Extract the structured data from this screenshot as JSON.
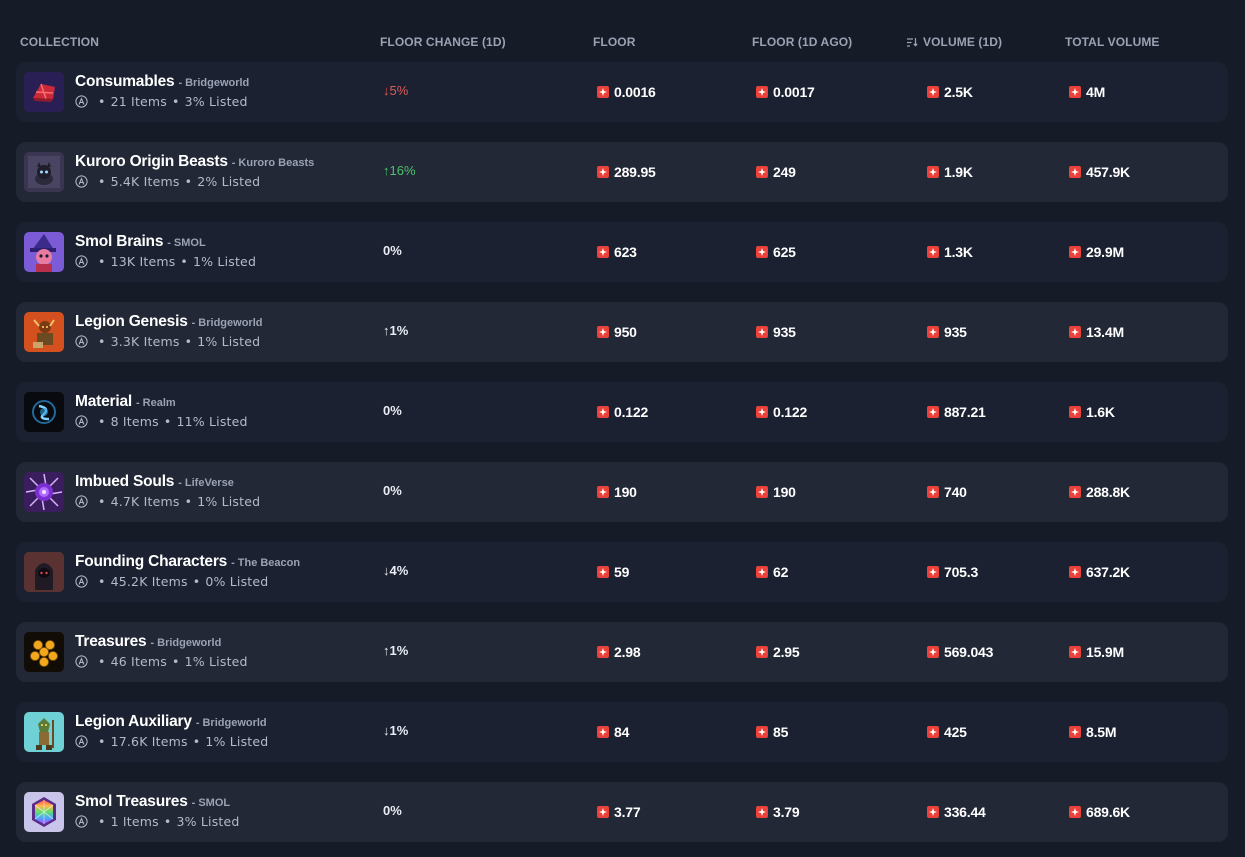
{
  "header": {
    "collection": "COLLECTION",
    "floor_change": "FLOOR CHANGE (1D)",
    "floor": "FLOOR",
    "floor_1d_ago": "FLOOR (1D AGO)",
    "volume_1d": "VOLUME (1D)",
    "total_volume": "TOTAL VOLUME"
  },
  "colors": {
    "background": "#161b28",
    "row": "#222836",
    "row_alt": "#1b2130",
    "magic_red": "#e8423a",
    "change_red": "#e05a5a",
    "change_green": "#4cc36c"
  },
  "icons": {
    "currency": "magic-token-icon",
    "chain": "arbitrum-icon",
    "sort": "sort-descending-icon"
  },
  "collections": [
    {
      "name": "Consumables",
      "sep": "-",
      "project": "Bridgeworld",
      "items": "21 Items",
      "listed": "3% Listed",
      "change": "↓5%",
      "change_style": "down-red",
      "floor": "0.0016",
      "floor_ago": "0.0017",
      "volume": "2.5K",
      "total": "4M",
      "thumb": "consumables"
    },
    {
      "name": "Kuroro Origin Beasts",
      "sep": "-",
      "project": "Kuroro Beasts",
      "items": "5.4K Items",
      "listed": "2% Listed",
      "change": "↑16%",
      "change_style": "up-green",
      "floor": "289.95",
      "floor_ago": "249",
      "volume": "1.9K",
      "total": "457.9K",
      "thumb": "kuroro"
    },
    {
      "name": "Smol Brains",
      "sep": "-",
      "project": "SMOL",
      "items": "13K Items",
      "listed": "1% Listed",
      "change": "0%",
      "change_style": "",
      "floor": "623",
      "floor_ago": "625",
      "volume": "1.3K",
      "total": "29.9M",
      "thumb": "smol"
    },
    {
      "name": "Legion Genesis",
      "sep": "-",
      "project": "Bridgeworld",
      "items": "3.3K Items",
      "listed": "1% Listed",
      "change": "↑1%",
      "change_style": "",
      "floor": "950",
      "floor_ago": "935",
      "volume": "935",
      "total": "13.4M",
      "thumb": "legion"
    },
    {
      "name": "Material",
      "sep": "-",
      "project": "Realm",
      "items": "8 Items",
      "listed": "11% Listed",
      "change": "0%",
      "change_style": "",
      "floor": "0.122",
      "floor_ago": "0.122",
      "volume": "887.21",
      "total": "1.6K",
      "thumb": "material"
    },
    {
      "name": "Imbued Souls",
      "sep": "-",
      "project": "LifeVerse",
      "items": "4.7K Items",
      "listed": "1% Listed",
      "change": "0%",
      "change_style": "",
      "floor": "190",
      "floor_ago": "190",
      "volume": "740",
      "total": "288.8K",
      "thumb": "souls"
    },
    {
      "name": "Founding Characters",
      "sep": "-",
      "project": "The Beacon",
      "items": "45.2K Items",
      "listed": "0% Listed",
      "change": "↓4%",
      "change_style": "",
      "floor": "59",
      "floor_ago": "62",
      "volume": "705.3",
      "total": "637.2K",
      "thumb": "beacon"
    },
    {
      "name": "Treasures",
      "sep": "-",
      "project": "Bridgeworld",
      "items": "46 Items",
      "listed": "1% Listed",
      "change": "↑1%",
      "change_style": "",
      "floor": "2.98",
      "floor_ago": "2.95",
      "volume": "569.043",
      "total": "15.9M",
      "thumb": "treasures"
    },
    {
      "name": "Legion Auxiliary",
      "sep": "-",
      "project": "Bridgeworld",
      "items": "17.6K Items",
      "listed": "1% Listed",
      "change": "↓1%",
      "change_style": "",
      "floor": "84",
      "floor_ago": "85",
      "volume": "425",
      "total": "8.5M",
      "thumb": "auxiliary"
    },
    {
      "name": "Smol Treasures",
      "sep": "-",
      "project": "SMOL",
      "items": "1 Items",
      "listed": "3% Listed",
      "change": "0%",
      "change_style": "",
      "floor": "3.77",
      "floor_ago": "3.79",
      "volume": "336.44",
      "total": "689.6K",
      "thumb": "smoltreasures"
    }
  ]
}
